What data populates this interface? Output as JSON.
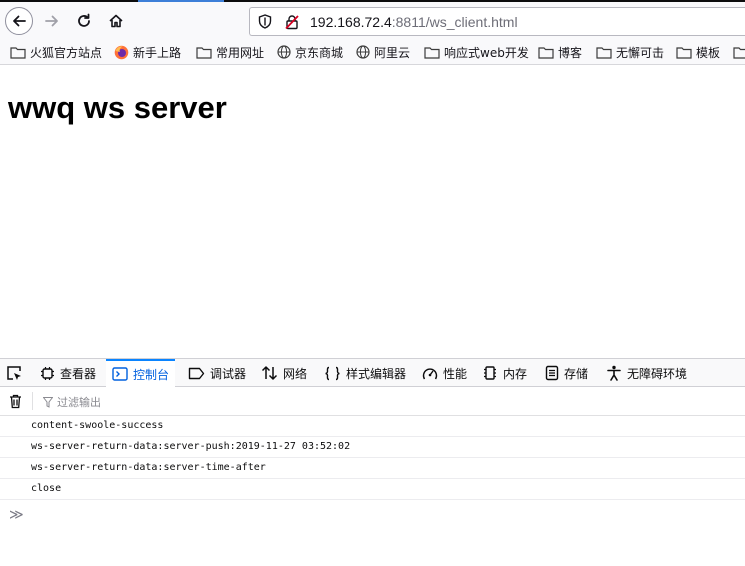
{
  "browser": {
    "address": {
      "host": "192.168.72.4",
      "port_path": ":8811/ws_client.html"
    }
  },
  "bookmarks": [
    {
      "label": "火狐官方站点",
      "icon": "folder-icon"
    },
    {
      "label": "新手上路",
      "icon": "firefox-icon"
    },
    {
      "label": "常用网址",
      "icon": "folder-icon"
    },
    {
      "label": "京东商城",
      "icon": "globe-icon"
    },
    {
      "label": "阿里云",
      "icon": "globe-icon"
    },
    {
      "label": "响应式web开发",
      "icon": "folder-icon"
    },
    {
      "label": "博客",
      "icon": "folder-icon"
    },
    {
      "label": "无懈可击",
      "icon": "folder-icon"
    },
    {
      "label": "模板",
      "icon": "folder-icon"
    }
  ],
  "page": {
    "heading": "wwq ws server"
  },
  "devtools": {
    "tabs": [
      {
        "label": "查看器",
        "icon": "inspector-icon"
      },
      {
        "label": "控制台",
        "icon": "console-icon",
        "active": true
      },
      {
        "label": "调试器",
        "icon": "debugger-icon"
      },
      {
        "label": "网络",
        "icon": "network-icon"
      },
      {
        "label": "样式编辑器",
        "icon": "style-editor-icon"
      },
      {
        "label": "性能",
        "icon": "performance-icon"
      },
      {
        "label": "内存",
        "icon": "memory-icon"
      },
      {
        "label": "存储",
        "icon": "storage-icon"
      },
      {
        "label": "无障碍环境",
        "icon": "accessibility-icon"
      }
    ],
    "filter_placeholder": "过滤输出",
    "console_lines": [
      "content-swoole-success",
      "ws-server-return-data:server-push:2019-11-27 03:52:02",
      "ws-server-return-data:server-time-after",
      "close"
    ],
    "prompt_symbol": "≫"
  },
  "colors": {
    "accent": "#0a84ff",
    "insecure": "#d70022"
  }
}
